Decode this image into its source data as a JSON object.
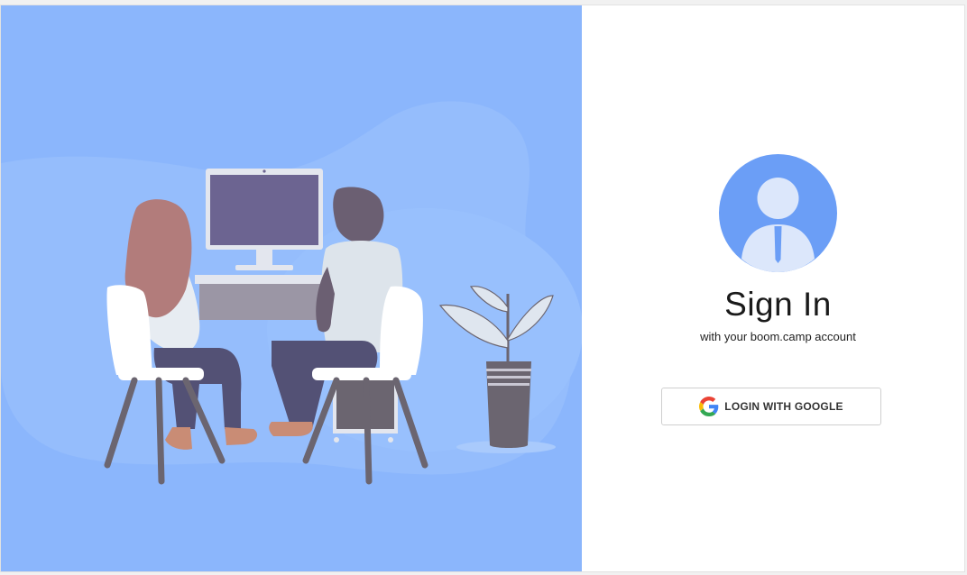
{
  "signin": {
    "title": "Sign In",
    "subtitle": "with your boom.camp account",
    "google_button_label": "LOGIN WITH GOOGLE"
  },
  "colors": {
    "illustration_background": "#8bb6fc",
    "avatar_background": "#6b9ef6",
    "page_background": "#ffffff"
  },
  "icons": {
    "avatar": "user-avatar-icon",
    "google": "google-logo-icon"
  }
}
